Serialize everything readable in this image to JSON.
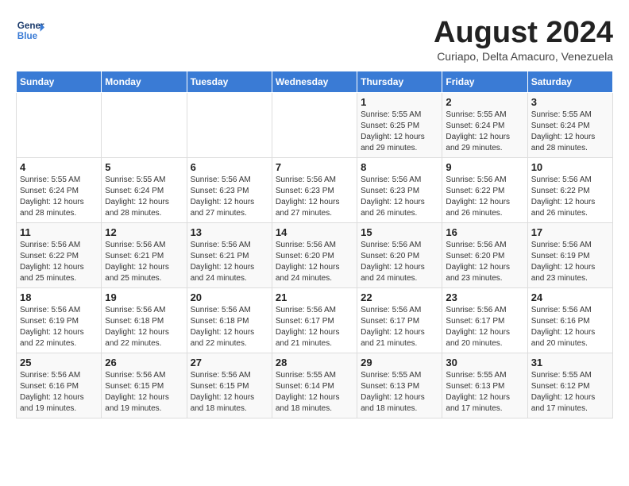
{
  "header": {
    "logo_line1": "General",
    "logo_line2": "Blue",
    "month_title": "August 2024",
    "subtitle": "Curiapo, Delta Amacuro, Venezuela"
  },
  "weekdays": [
    "Sunday",
    "Monday",
    "Tuesday",
    "Wednesday",
    "Thursday",
    "Friday",
    "Saturday"
  ],
  "weeks": [
    [
      {
        "day": "",
        "info": ""
      },
      {
        "day": "",
        "info": ""
      },
      {
        "day": "",
        "info": ""
      },
      {
        "day": "",
        "info": ""
      },
      {
        "day": "1",
        "info": "Sunrise: 5:55 AM\nSunset: 6:25 PM\nDaylight: 12 hours\nand 29 minutes."
      },
      {
        "day": "2",
        "info": "Sunrise: 5:55 AM\nSunset: 6:24 PM\nDaylight: 12 hours\nand 29 minutes."
      },
      {
        "day": "3",
        "info": "Sunrise: 5:55 AM\nSunset: 6:24 PM\nDaylight: 12 hours\nand 28 minutes."
      }
    ],
    [
      {
        "day": "4",
        "info": "Sunrise: 5:55 AM\nSunset: 6:24 PM\nDaylight: 12 hours\nand 28 minutes."
      },
      {
        "day": "5",
        "info": "Sunrise: 5:55 AM\nSunset: 6:24 PM\nDaylight: 12 hours\nand 28 minutes."
      },
      {
        "day": "6",
        "info": "Sunrise: 5:56 AM\nSunset: 6:23 PM\nDaylight: 12 hours\nand 27 minutes."
      },
      {
        "day": "7",
        "info": "Sunrise: 5:56 AM\nSunset: 6:23 PM\nDaylight: 12 hours\nand 27 minutes."
      },
      {
        "day": "8",
        "info": "Sunrise: 5:56 AM\nSunset: 6:23 PM\nDaylight: 12 hours\nand 26 minutes."
      },
      {
        "day": "9",
        "info": "Sunrise: 5:56 AM\nSunset: 6:22 PM\nDaylight: 12 hours\nand 26 minutes."
      },
      {
        "day": "10",
        "info": "Sunrise: 5:56 AM\nSunset: 6:22 PM\nDaylight: 12 hours\nand 26 minutes."
      }
    ],
    [
      {
        "day": "11",
        "info": "Sunrise: 5:56 AM\nSunset: 6:22 PM\nDaylight: 12 hours\nand 25 minutes."
      },
      {
        "day": "12",
        "info": "Sunrise: 5:56 AM\nSunset: 6:21 PM\nDaylight: 12 hours\nand 25 minutes."
      },
      {
        "day": "13",
        "info": "Sunrise: 5:56 AM\nSunset: 6:21 PM\nDaylight: 12 hours\nand 24 minutes."
      },
      {
        "day": "14",
        "info": "Sunrise: 5:56 AM\nSunset: 6:20 PM\nDaylight: 12 hours\nand 24 minutes."
      },
      {
        "day": "15",
        "info": "Sunrise: 5:56 AM\nSunset: 6:20 PM\nDaylight: 12 hours\nand 24 minutes."
      },
      {
        "day": "16",
        "info": "Sunrise: 5:56 AM\nSunset: 6:20 PM\nDaylight: 12 hours\nand 23 minutes."
      },
      {
        "day": "17",
        "info": "Sunrise: 5:56 AM\nSunset: 6:19 PM\nDaylight: 12 hours\nand 23 minutes."
      }
    ],
    [
      {
        "day": "18",
        "info": "Sunrise: 5:56 AM\nSunset: 6:19 PM\nDaylight: 12 hours\nand 22 minutes."
      },
      {
        "day": "19",
        "info": "Sunrise: 5:56 AM\nSunset: 6:18 PM\nDaylight: 12 hours\nand 22 minutes."
      },
      {
        "day": "20",
        "info": "Sunrise: 5:56 AM\nSunset: 6:18 PM\nDaylight: 12 hours\nand 22 minutes."
      },
      {
        "day": "21",
        "info": "Sunrise: 5:56 AM\nSunset: 6:17 PM\nDaylight: 12 hours\nand 21 minutes."
      },
      {
        "day": "22",
        "info": "Sunrise: 5:56 AM\nSunset: 6:17 PM\nDaylight: 12 hours\nand 21 minutes."
      },
      {
        "day": "23",
        "info": "Sunrise: 5:56 AM\nSunset: 6:17 PM\nDaylight: 12 hours\nand 20 minutes."
      },
      {
        "day": "24",
        "info": "Sunrise: 5:56 AM\nSunset: 6:16 PM\nDaylight: 12 hours\nand 20 minutes."
      }
    ],
    [
      {
        "day": "25",
        "info": "Sunrise: 5:56 AM\nSunset: 6:16 PM\nDaylight: 12 hours\nand 19 minutes."
      },
      {
        "day": "26",
        "info": "Sunrise: 5:56 AM\nSunset: 6:15 PM\nDaylight: 12 hours\nand 19 minutes."
      },
      {
        "day": "27",
        "info": "Sunrise: 5:56 AM\nSunset: 6:15 PM\nDaylight: 12 hours\nand 18 minutes."
      },
      {
        "day": "28",
        "info": "Sunrise: 5:55 AM\nSunset: 6:14 PM\nDaylight: 12 hours\nand 18 minutes."
      },
      {
        "day": "29",
        "info": "Sunrise: 5:55 AM\nSunset: 6:13 PM\nDaylight: 12 hours\nand 18 minutes."
      },
      {
        "day": "30",
        "info": "Sunrise: 5:55 AM\nSunset: 6:13 PM\nDaylight: 12 hours\nand 17 minutes."
      },
      {
        "day": "31",
        "info": "Sunrise: 5:55 AM\nSunset: 6:12 PM\nDaylight: 12 hours\nand 17 minutes."
      }
    ]
  ]
}
